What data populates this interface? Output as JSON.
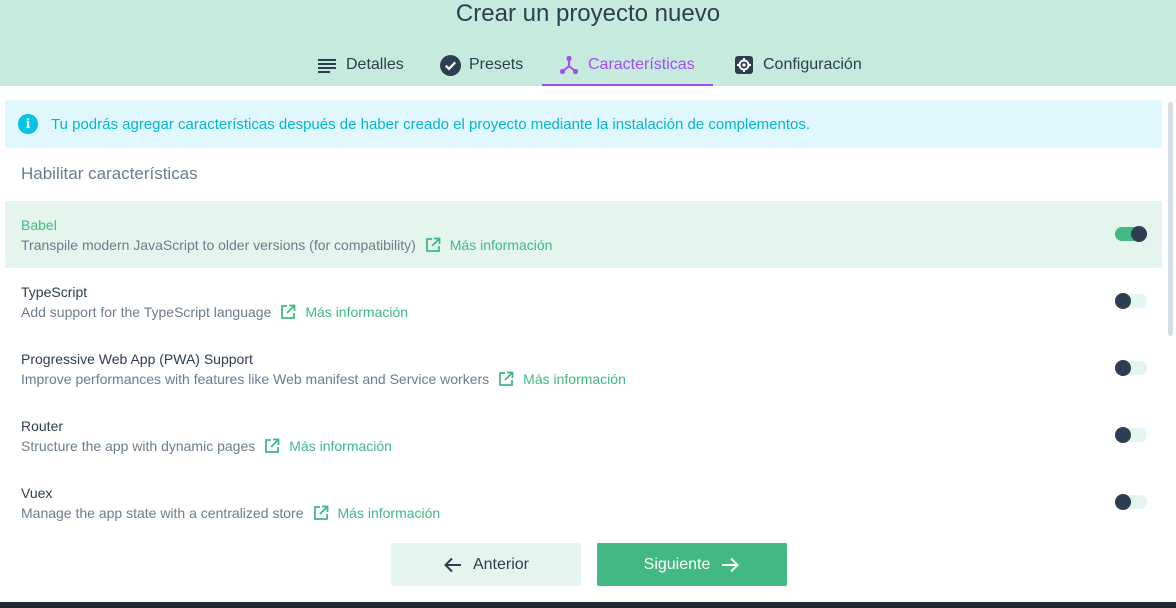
{
  "header": {
    "title": "Crear un proyecto nuevo",
    "tabs": [
      {
        "label": "Detalles",
        "icon": "list-icon"
      },
      {
        "label": "Presets",
        "icon": "check-circle-icon"
      },
      {
        "label": "Características",
        "icon": "fork-icon"
      },
      {
        "label": "Configuración",
        "icon": "gear-icon"
      }
    ],
    "active_tab": "Características"
  },
  "info": {
    "text": "Tu podrás agregar características después de haber creado el proyecto mediante la instalación de complementos."
  },
  "section_title": "Habilitar características",
  "features": [
    {
      "name": "Babel",
      "description": "Transpile modern JavaScript to older versions (for compatibility)",
      "link": "Más información",
      "enabled": true
    },
    {
      "name": "TypeScript",
      "description": "Add support for the TypeScript language",
      "link": "Más información",
      "enabled": false
    },
    {
      "name": "Progressive Web App (PWA) Support",
      "description": "Improve performances with features like Web manifest and Service workers",
      "link": "Más información",
      "enabled": false
    },
    {
      "name": "Router",
      "description": "Structure the app with dynamic pages",
      "link": "Más información",
      "enabled": false
    },
    {
      "name": "Vuex",
      "description": "Manage the app state with a centralized store",
      "link": "Más información",
      "enabled": false
    }
  ],
  "buttons": {
    "previous": "Anterior",
    "next": "Siguiente"
  },
  "colors": {
    "header_bg": "#c6eadd",
    "accent_green": "#42b983",
    "active_tab": "#a44cf6",
    "info_text": "#03b5d6",
    "dark": "#2c3e50"
  }
}
